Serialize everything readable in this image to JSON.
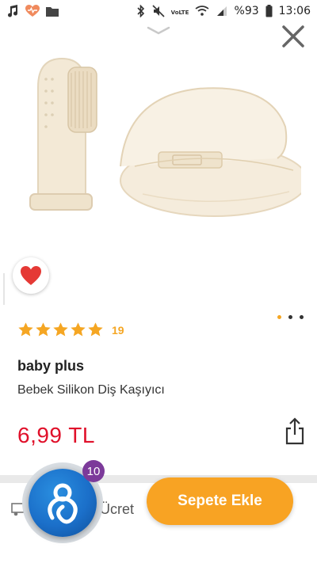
{
  "status_bar": {
    "left_icons": [
      "music-note-icon",
      "health-heart-icon",
      "folder-icon"
    ],
    "network_label": "VoLTE",
    "battery_text": "%93",
    "time": "13:06"
  },
  "product": {
    "brand": "baby plus",
    "name": "Bebek Silikon Diş Kaşıyıcı",
    "price": "6,99 TL",
    "rating_stars": 5,
    "review_count": "19",
    "gallery_page_count": 3,
    "gallery_active_index": 0
  },
  "shipping": {
    "label": "Ücret"
  },
  "assistant": {
    "badge_count": "10"
  },
  "cta": {
    "add_to_cart_label": "Sepete Ekle"
  },
  "colors": {
    "accent": "#f8a323",
    "price": "#e0102a",
    "star": "#f5a623",
    "favorite": "#e53935",
    "badge": "#7c3a9a"
  }
}
